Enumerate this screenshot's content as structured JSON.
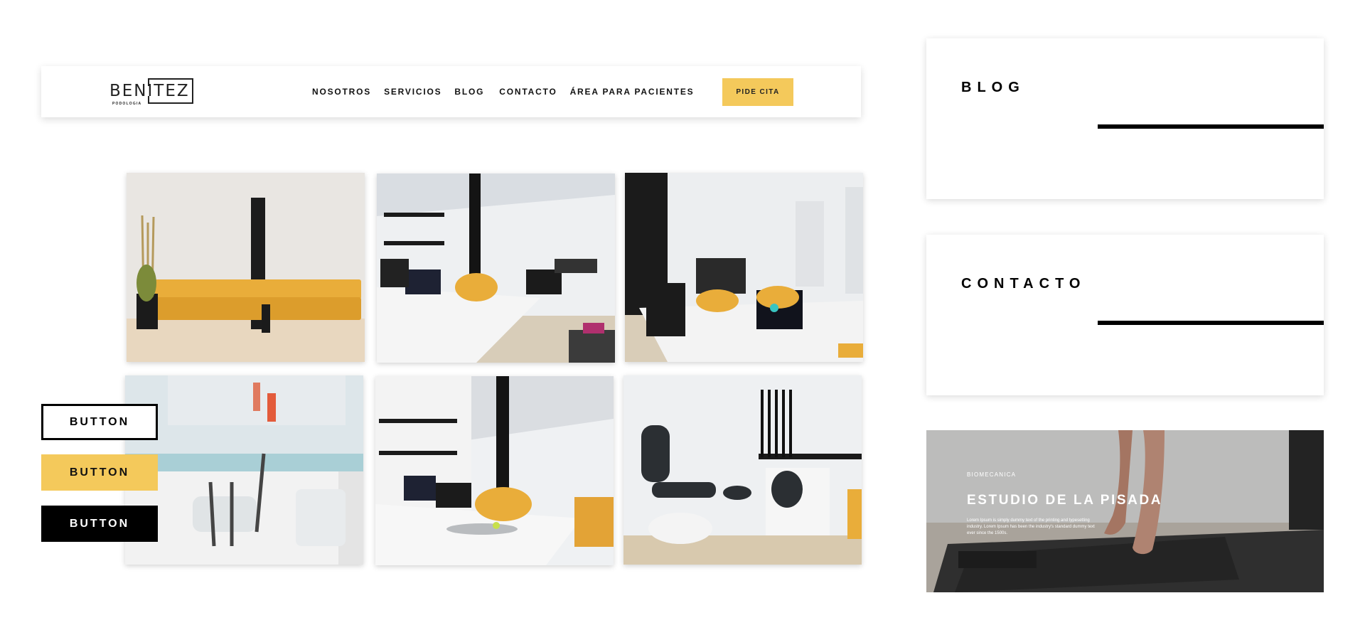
{
  "header": {
    "logo": {
      "word": "BENITEZ",
      "subtitle": "PODOLOGIA"
    },
    "nav": [
      "NOSOTROS",
      "SERVICIOS",
      "BLOG",
      "CONTACTO",
      "ÁREA PARA PACIENTES"
    ],
    "cta_label": "PIDE CITA"
  },
  "gallery": {
    "photos": [
      "waiting-room-yellow-sofa",
      "clinic-desk-with-laptop-and-treadmill",
      "biomechanics-room-with-laptop",
      "podiatry-instrument-tray",
      "clinic-desk-with-monitor",
      "podiatry-treatment-chair"
    ]
  },
  "buttons": {
    "outline_label": "BUTTON",
    "yellow_label": "BUTTON",
    "black_label": "BUTTON"
  },
  "cards": {
    "blog_title": "BLOG",
    "contact_title": "CONTACTO"
  },
  "feature": {
    "eyebrow": "BIOMECANICA",
    "title": "ESTUDIO DE LA PISADA",
    "body": "Lorem Ipsum is simply dummy text of the printing and typesetting industry. Lorem Ipsum has been the industry's standard dummy text ever since the 1500s."
  },
  "colors": {
    "accent_yellow": "#f4c95b",
    "black": "#000000",
    "white": "#ffffff"
  }
}
